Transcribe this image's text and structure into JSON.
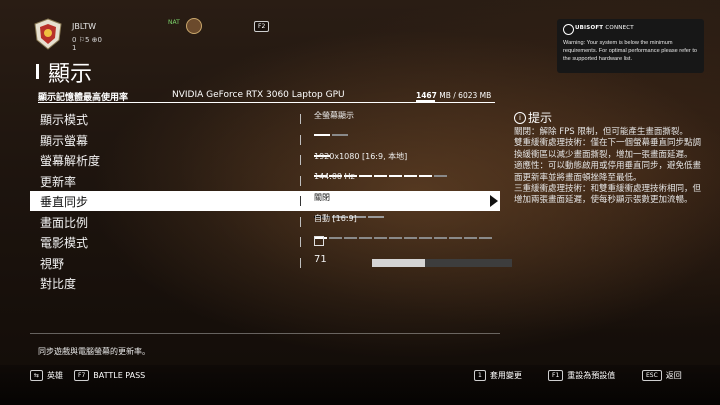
{
  "player": {
    "username": "JBLTW",
    "stats": "0 ⚐5 ⊕0",
    "level": "1",
    "nat_label": "NAT",
    "f2_key": "F2"
  },
  "ubisoft": {
    "brand_bold": "UBISOFT",
    "brand_light": "CONNECT",
    "message": "Warning: Your system is below the minimum requirements. For optimal performance please refer to the supported hardware list."
  },
  "page": {
    "title": "顯示",
    "vram_label": "顯示記憶體最高使用率",
    "gpu_name": "NVIDIA GeForce RTX 3060 Laptop GPU",
    "vram_used": "1467",
    "vram_total": "MB / 6023 MB",
    "vram_fraction": 0.244
  },
  "settings": [
    {
      "label": "顯示模式",
      "value": "全螢幕顯示",
      "bars": 2,
      "bars_on": 1
    },
    {
      "label": "顯示螢幕",
      "value": "",
      "bars": 1,
      "bars_on": 1
    },
    {
      "label": "螢幕解析度",
      "value": "1920x1080 [16:9, 本地]",
      "bars": 9,
      "bars_on": 8
    },
    {
      "label": "更新率",
      "value": "144.00 Hz",
      "bars": 2,
      "bars_on": 1
    },
    {
      "label": "垂直同步",
      "value": "關閉",
      "bars": 4,
      "bars_on": 1,
      "selected": true
    },
    {
      "label": "畫面比例",
      "value": "自動 [16:9]",
      "bars": 12,
      "bars_on": 1
    },
    {
      "label": "電影模式",
      "value": "",
      "checkbox": true
    },
    {
      "label": "視野",
      "value": "71",
      "slider": 0.38
    },
    {
      "label": "對比度",
      "value": ""
    }
  ],
  "hint": {
    "icon": "i",
    "title": "提示",
    "body": "關閉：解除 FPS 限制，但可能產生畫面撕裂。\n雙重緩衝處理技術：僅在下一個螢幕垂直同步點調換緩衝區以減少畫面撕裂，增加一張畫面延遲。\n適應性：可以動態啟用或停用垂直同步，避免低畫面更新率並將畫面頓挫降至最低。\n三重緩衝處理技術：和雙重緩衝處理技術相同，但增加兩張畫面延遲，使每秒顯示張數更加流暢。"
  },
  "description": "同步遊戲與電腦螢幕的更新率。",
  "bottom": {
    "heroes_key": "⇆",
    "heroes": "英雄",
    "battlepass_key": "F7",
    "battlepass": "BATTLE PASS",
    "apply_key": "1",
    "apply": "套用變更",
    "reset_key": "F1",
    "reset": "重設為預設值",
    "back_key": "ESC",
    "back": "返回"
  }
}
